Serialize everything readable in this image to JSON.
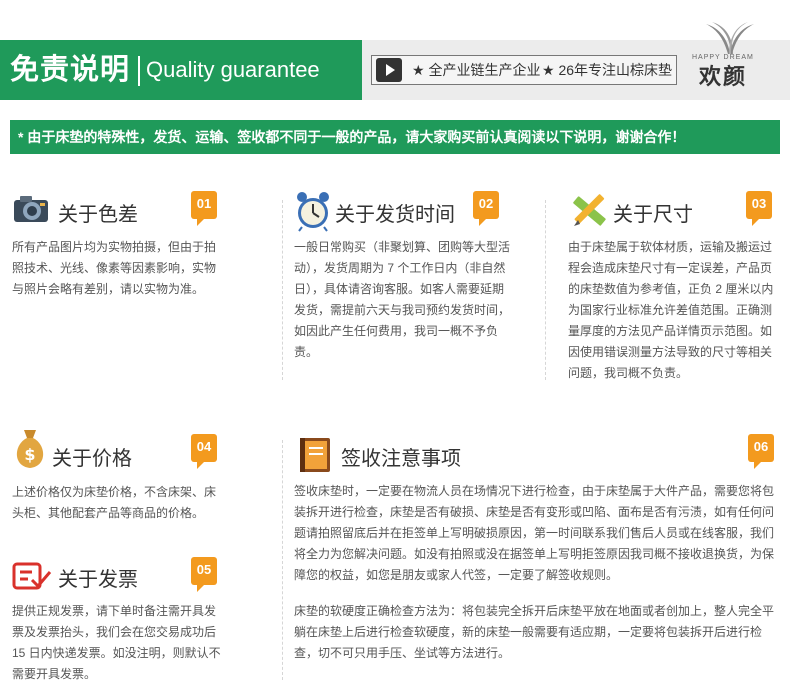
{
  "header": {
    "title": "免责说明",
    "subtitle": "Quality guarantee",
    "slogan1": "★ 全产业链生产企业",
    "slogan2": "★ 26年专注山棕床垫",
    "logo_en": "HAPPY DREAM",
    "logo_cn": "欢颜"
  },
  "notice": "* 由于床垫的特殊性，发货、运输、签收都不同于一般的产品，请大家购买前认真阅读以下说明，谢谢合作！",
  "sections": [
    {
      "title": "关于色差",
      "badge": "01",
      "icon": "camera-icon",
      "body": "所有产品图片均为实物拍摄，但由于拍照技术、光线、像素等因素影响，实物与照片会略有差别，请以实物为准。"
    },
    {
      "title": "关于发货时间",
      "badge": "02",
      "icon": "alarm-clock-icon",
      "body": "一般日常购买（非聚划算、团购等大型活动），发货周期为 7 个工作日内（非自然日），具体请咨询客服。如客人需要延期发货，需提前六天与我司预约发货时间，如因此产生任何费用，我司一概不予负责。"
    },
    {
      "title": "关于尺寸",
      "badge": "03",
      "icon": "ruler-pencil-icon",
      "body": "由于床垫属于软体材质，运输及搬运过程会造成床垫尺寸有一定误差，产品页的床垫数值为参考值，正负 2 厘米以内为国家行业标准允许差值范围。正确测量厚度的方法见产品详情页示范图。如因使用错误测量方法导致的尺寸等相关问题，我司概不负责。"
    },
    {
      "title": "关于价格",
      "badge": "04",
      "icon": "money-bag-icon",
      "body": "上述价格仅为床垫价格，不含床架、床头柜、其他配套产品等商品的价格。"
    },
    {
      "title": "关于发票",
      "badge": "05",
      "icon": "invoice-icon",
      "body": "提供正规发票，请下单时备注需开具发票及发票抬头，我们会在您交易成功后 15 日内快递发票。如没注明，则默认不需要开具发票。"
    },
    {
      "title": "签收注意事项",
      "badge": "06",
      "icon": "notebook-icon",
      "body": "签收床垫时，一定要在物流人员在场情况下进行检查，由于床垫属于大件产品，需要您将包装拆开进行检查，床垫是否有破损、床垫是否有变形或凹陷、面布是否有污渍，如有任何问题请拍照留底后并在拒签单上写明破损原因，第一时间联系我们售后人员或在线客服，我们将全力为您解决问题。如没有拍照或没在据签单上写明拒签原因我司概不接收退换货，为保障您的权益，如您是朋友或家人代签，一定要了解签收规则。",
      "body2": "床垫的软硬度正确检查方法为：将包装完全拆开后床垫平放在地面或者创加上，整人完全平躺在床垫上后进行检查软硬度，新的床垫一般需要有适应期，一定要将包装拆开后进行检查，切不可只用手压、坐试等方法进行。"
    }
  ],
  "colors": {
    "brand_green": "#1f9a5a",
    "badge_orange": "#f39a1e"
  }
}
